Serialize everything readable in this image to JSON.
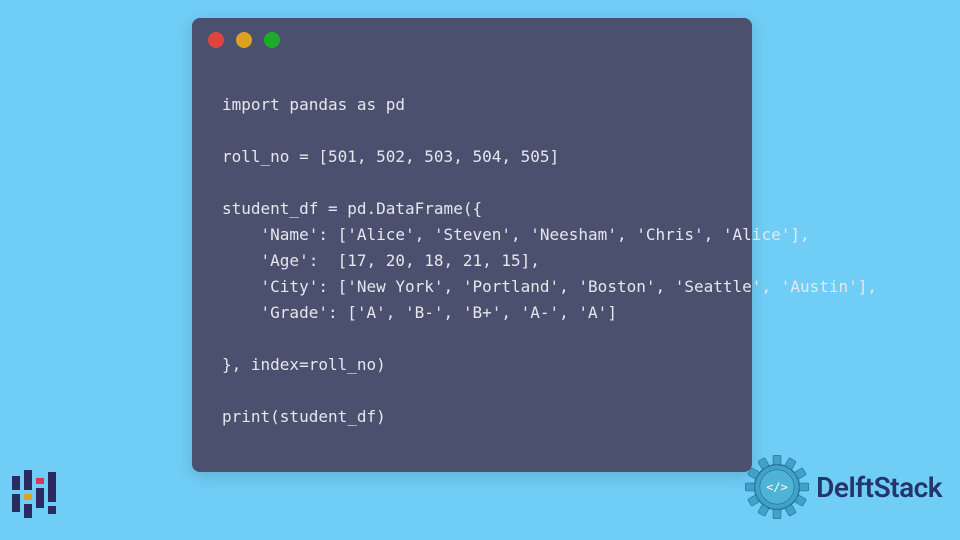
{
  "code": {
    "lines": [
      "import pandas as pd",
      "",
      "roll_no = [501, 502, 503, 504, 505]",
      "",
      "student_df = pd.DataFrame({",
      "    'Name': ['Alice', 'Steven', 'Neesham', 'Chris', 'Alice'],",
      "    'Age':  [17, 20, 18, 21, 15],",
      "    'City': ['New York', 'Portland', 'Boston', 'Seattle', 'Austin'],",
      "    'Grade': ['A', 'B-', 'B+', 'A-', 'A']",
      "",
      "}, index=roll_no)",
      "",
      "print(student_df)"
    ]
  },
  "brand": {
    "name": "DelftStack"
  },
  "colors": {
    "page_bg": "#70cdf6",
    "window_bg": "#4a506e",
    "code_fg": "#e6e7ec",
    "dot_red": "#e0443e",
    "dot_yellow": "#dea123",
    "dot_green": "#1aab29",
    "brand_text": "#24356a",
    "gear_fill": "#3fa3c7",
    "gear_stroke": "#2c6fa0"
  }
}
